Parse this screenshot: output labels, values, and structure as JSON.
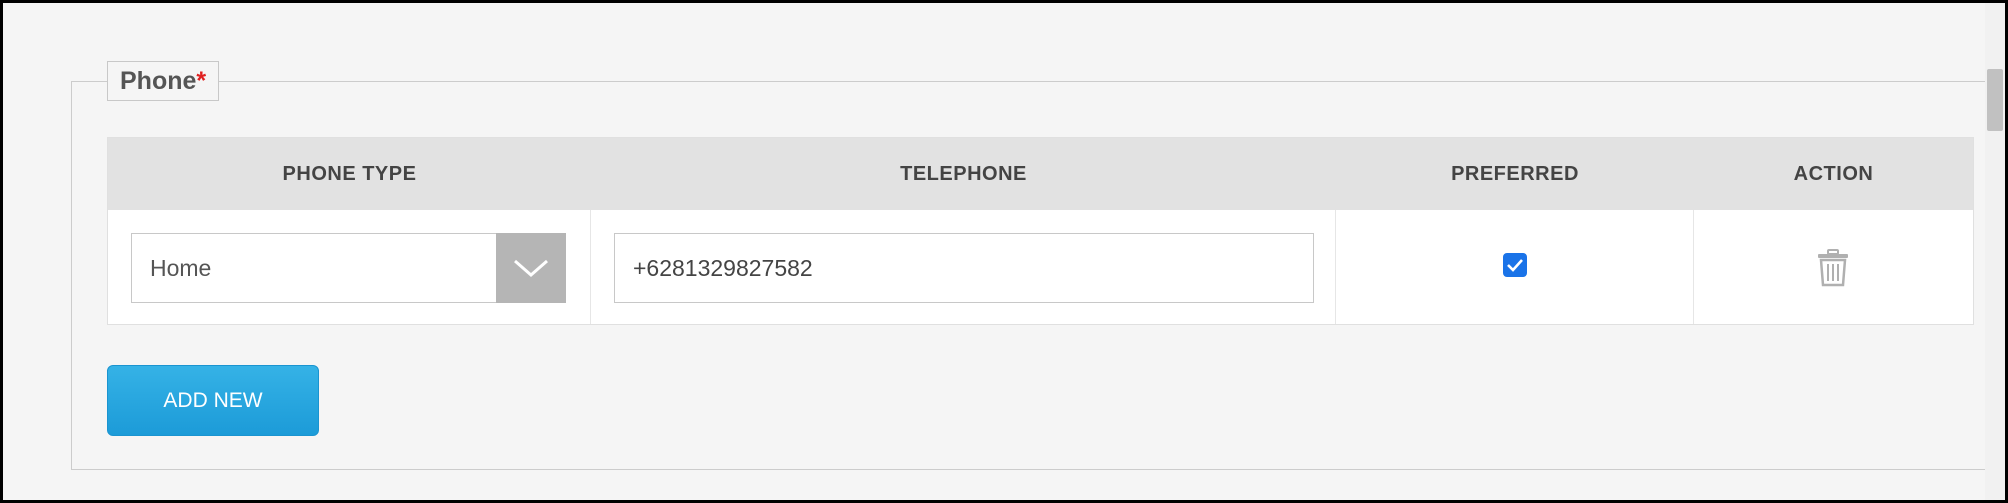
{
  "section": {
    "legend": "Phone",
    "required_mark": "*"
  },
  "table": {
    "headers": {
      "phone_type": "PHONE TYPE",
      "telephone": "TELEPHONE",
      "preferred": "PREFERRED",
      "action": "ACTION"
    },
    "rows": [
      {
        "phone_type": "Home",
        "telephone": "+6281329827582",
        "preferred": true
      }
    ]
  },
  "add_button": {
    "label": "ADD NEW"
  },
  "colors": {
    "accent": "#1c9bd8",
    "required": "#e02020",
    "checkbox": "#1a73e8",
    "header_bg": "#e2e2e2"
  },
  "icons": {
    "dropdown": "chevron-down-icon",
    "delete": "trash-icon",
    "check": "checkmark-icon"
  }
}
